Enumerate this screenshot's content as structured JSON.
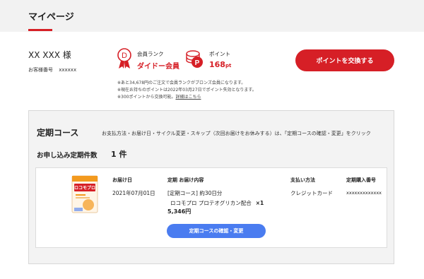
{
  "header": {
    "title": "マイページ"
  },
  "user": {
    "name": "XX XXX 様",
    "member_no_label": "お客様番号",
    "member_no_value": "xxxxxx"
  },
  "rank": {
    "label": "会員ランク",
    "value": "ダイドー会員",
    "icon_letter": "D"
  },
  "points": {
    "label": "ポイント",
    "value": "168",
    "unit": "pt",
    "icon_letter": "P"
  },
  "exchange_button": "ポイントを交換する",
  "notes": {
    "line1": "※あと34,678円のご注文で会員ランクがブロンズ会員になります。",
    "line2": "※現在お持ちのポイントは2022年03月27日でポイント失効となります。",
    "line3": "※300ポイントから交換可能。",
    "line3_link": "詳細はこちら"
  },
  "subscription": {
    "title": "定期コース",
    "description": "お支払方法・お届け日・サイクル変更・スキップ（次回お届けをお休みする）は、「定期コースの確認・変更」をクリック",
    "count_label": "お申し込み定期件数",
    "count_value": "1 件",
    "headers": {
      "date": "お届け日",
      "content": "定期 お届け内容",
      "payment": "支払い方法",
      "order_no": "定期購入番号"
    },
    "item": {
      "date": "2021年07月01日",
      "course": "[定期コース] 約30日分",
      "product_name": "ロコモプロ プロテオグリカン配合",
      "quantity": "×1",
      "price": "5,346円",
      "payment": "クレジットカード",
      "order_no": "xxxxxxxxxxxxx",
      "package_text": "ロコモプロ"
    },
    "confirm_button": "定期コースの確認・変更"
  },
  "colors": {
    "accent": "#d61f26",
    "button_blue": "#4a7cf0"
  }
}
